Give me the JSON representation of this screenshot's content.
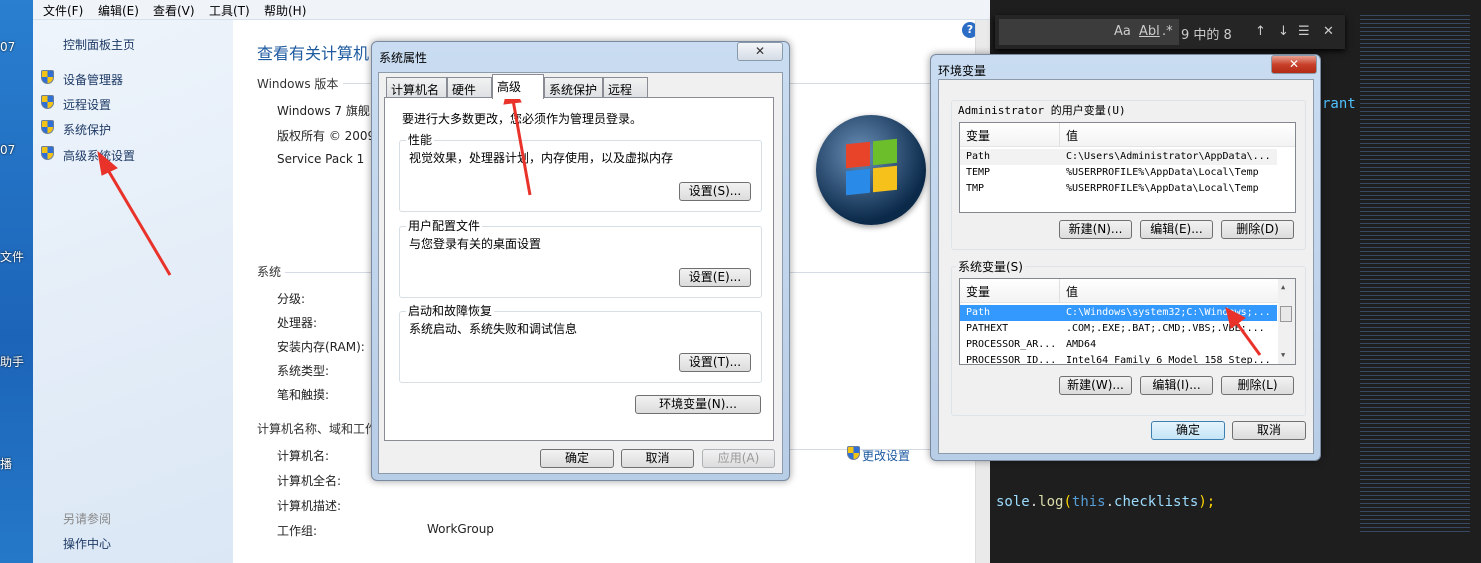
{
  "desktop": {
    "labels": [
      "07",
      "07",
      "文件",
      "助手",
      "播"
    ]
  },
  "explorer": {
    "menu": [
      "文件(F)",
      "编辑(E)",
      "查看(V)",
      "工具(T)",
      "帮助(H)"
    ],
    "left": {
      "home": "控制面板主页",
      "items": [
        "设备管理器",
        "远程设置",
        "系统保护",
        "高级系统设置"
      ],
      "see_also": "另请参阅",
      "see_also_items": [
        "操作中心"
      ]
    },
    "title": "查看有关计算机",
    "edition": {
      "heading": "Windows 版本",
      "lines": [
        "Windows 7 旗舰",
        "版权所有 © 2009",
        "Service Pack 1"
      ]
    },
    "system": {
      "heading": "系统",
      "labels": [
        "分级:",
        "处理器:",
        "安装内存(RAM):",
        "系统类型:",
        "笔和触摸:"
      ]
    },
    "computer": {
      "heading": "计算机名称、域和工作",
      "labels": [
        "计算机名:",
        "计算机全名:",
        "计算机描述:",
        "工作组:"
      ],
      "workgroup": "WorkGroup",
      "change": "更改设置"
    }
  },
  "sysprops": {
    "title": "系统属性",
    "close": "✕",
    "tabs": [
      "计算机名",
      "硬件",
      "高级",
      "系统保护",
      "远程"
    ],
    "active_tab": "高级",
    "notice": "要进行大多数更改，您必须作为管理员登录。",
    "groups": [
      {
        "label": "性能",
        "desc": "视觉效果，处理器计划，内存使用，以及虚拟内存",
        "button": "设置(S)..."
      },
      {
        "label": "用户配置文件",
        "desc": "与您登录有关的桌面设置",
        "button": "设置(E)..."
      },
      {
        "label": "启动和故障恢复",
        "desc": "系统启动、系统失败和调试信息",
        "button": "设置(T)..."
      }
    ],
    "env_button": "环境变量(N)...",
    "ok": "确定",
    "cancel": "取消",
    "apply": "应用(A)"
  },
  "envvars": {
    "title": "环境变量",
    "close": "✕",
    "user_label": "Administrator 的用户变量(U)",
    "col_var": "变量",
    "col_val": "值",
    "user_rows": [
      [
        "Path",
        "C:\\Users\\Administrator\\AppData\\..."
      ],
      [
        "TEMP",
        "%USERPROFILE%\\AppData\\Local\\Temp"
      ],
      [
        "TMP",
        "%USERPROFILE%\\AppData\\Local\\Temp"
      ]
    ],
    "user_buttons": [
      "新建(N)...",
      "编辑(E)...",
      "删除(D)"
    ],
    "sys_label": "系统变量(S)",
    "sys_rows": [
      [
        "Path",
        "C:\\Windows\\system32;C:\\Windows;..."
      ],
      [
        "PATHEXT",
        ".COM;.EXE;.BAT;.CMD;.VBS;.VBE;..."
      ],
      [
        "PROCESSOR_AR...",
        "AMD64"
      ],
      [
        "PROCESSOR_ID...",
        "Intel64 Family 6 Model 158 Step..."
      ]
    ],
    "selected_sys_row": "Path",
    "sys_buttons": [
      "新建(W)...",
      "编辑(I)...",
      "删除(L)"
    ],
    "ok": "确定",
    "cancel": "取消"
  },
  "editor": {
    "find": {
      "case": "Aa",
      "word": "Abl",
      "regex": ".*",
      "count": "9 中的 8"
    },
    "code_top": "rant",
    "code_line": [
      "sole",
      ".",
      "log",
      "(",
      "this",
      ".",
      "checklists",
      ");"
    ]
  },
  "colors": {
    "accent": "#3399ff",
    "annotation_arrow": "#e8322a",
    "link": "#1e5aa0"
  }
}
